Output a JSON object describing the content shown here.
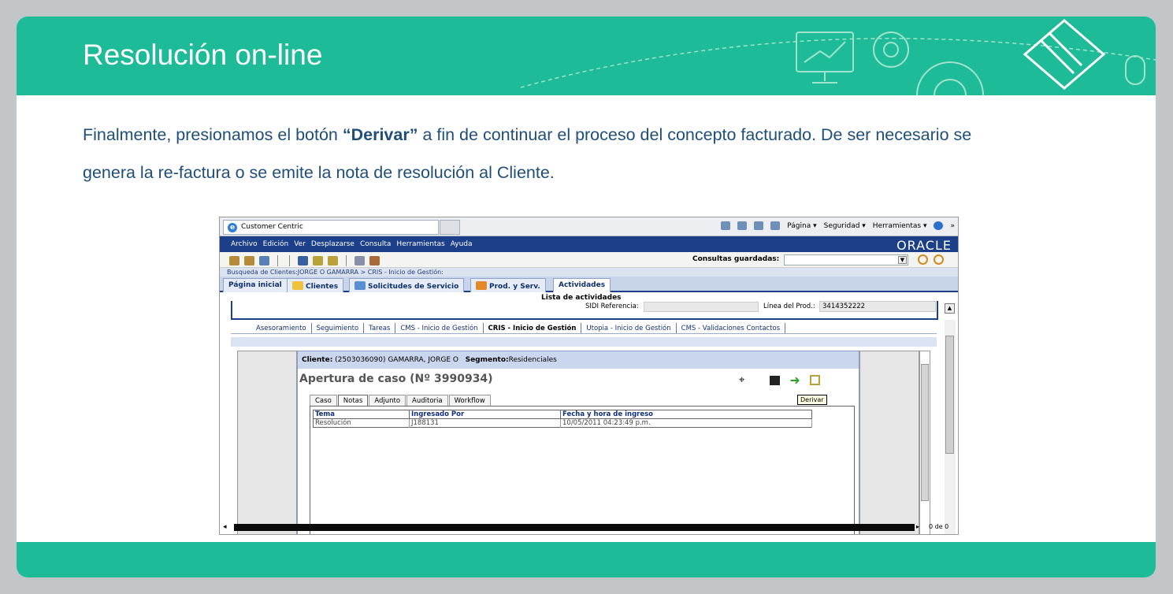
{
  "slide": {
    "title": "Resolución on-line",
    "paragraph": {
      "part1": "Finalmente, presionamos el botón ",
      "bold": "“Derivar”",
      "part2": " a fin de continuar el proceso del concepto facturado. De ser necesario se genera la re-factura o se emite la nota de  resolución al Cliente."
    }
  },
  "browser": {
    "tab_title": "Customer Centric",
    "commands": [
      "Página ▾",
      "Seguridad ▾",
      "Herramientas ▾"
    ]
  },
  "app": {
    "menu": [
      "Archivo",
      "Edición",
      "Ver",
      "Desplazarse",
      "Consulta",
      "Herramientas",
      "Ayuda"
    ],
    "brand": "ORACLE",
    "consultas_label": "Consultas guardadas:",
    "breadcrumb": "Busqueda de Clientes:JORGE O GAMARRA  > CRIS - Inicio de Gestión:",
    "nav_tabs": [
      {
        "label": "Página inicial"
      },
      {
        "label": "Clientes"
      },
      {
        "label": "Solicitudes de Servicio"
      },
      {
        "label": "Prod. y Serv."
      },
      {
        "label": "Actividades"
      }
    ],
    "lista_title": "Lista de actividades",
    "sidi_label": "SIDI Referencia:",
    "linea_label": "Línea del Prod.:",
    "linea_value": "3414352222",
    "sub_tabs": [
      "Asesoramiento",
      "Seguimiento",
      "Tareas",
      "CMS - Inicio de Gestión",
      "CRIS - Inicio de Gestión",
      "Utopia - Inicio de Gestión",
      "CMS - Validaciones Contactos"
    ],
    "client_label": "Cliente:",
    "client_value": "(2503036090) GAMARRA, JORGE O",
    "segment_label": "Segmento:",
    "segment_value": "Residenciales",
    "case_title": "Apertura de caso (Nº 3990934)",
    "derivar_tooltip": "Derivar",
    "case_tabs": [
      "Caso",
      "Notas",
      "Adjunto",
      "Auditoria",
      "Workflow"
    ],
    "grid": {
      "headers": [
        "Tema",
        "Ingresado Por",
        "Fecha y hora de ingreso"
      ],
      "rows": [
        [
          "Resolución",
          "J188131",
          "10/05/2011 04:23:49 p.m."
        ]
      ]
    },
    "page_count": "0 de 0"
  }
}
